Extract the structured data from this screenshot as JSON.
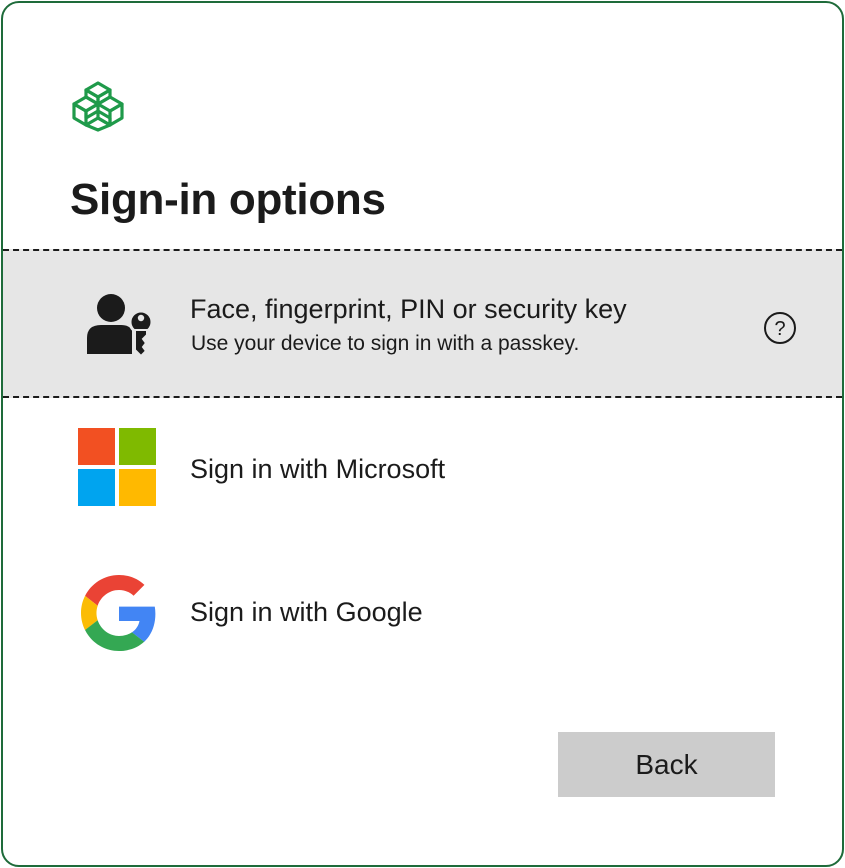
{
  "header": {
    "logo_icon": "green-cube-logo-icon",
    "title": "Sign-in options"
  },
  "options": [
    {
      "id": "passkey",
      "icon": "user-key-icon",
      "label": "Face, fingerprint, PIN or security key",
      "description": "Use your device to sign in with a passkey.",
      "help_icon": "question-circle-icon",
      "highlighted": true
    },
    {
      "id": "microsoft",
      "icon": "microsoft-logo-icon",
      "label": "Sign in with Microsoft"
    },
    {
      "id": "google",
      "icon": "google-logo-icon",
      "label": "Sign in with Google"
    }
  ],
  "footer": {
    "back_label": "Back"
  },
  "colors": {
    "border": "#1e6b3a",
    "logo_green": "#1f9a4a",
    "highlight_bg": "#e6e6e6",
    "button_bg": "#cccccc",
    "ms_red": "#f25022",
    "ms_green": "#7fba00",
    "ms_blue": "#00a4ef",
    "ms_yellow": "#ffb900",
    "google_blue": "#4285f4",
    "google_red": "#ea4335",
    "google_yellow": "#fbbc05",
    "google_green": "#34a853"
  }
}
